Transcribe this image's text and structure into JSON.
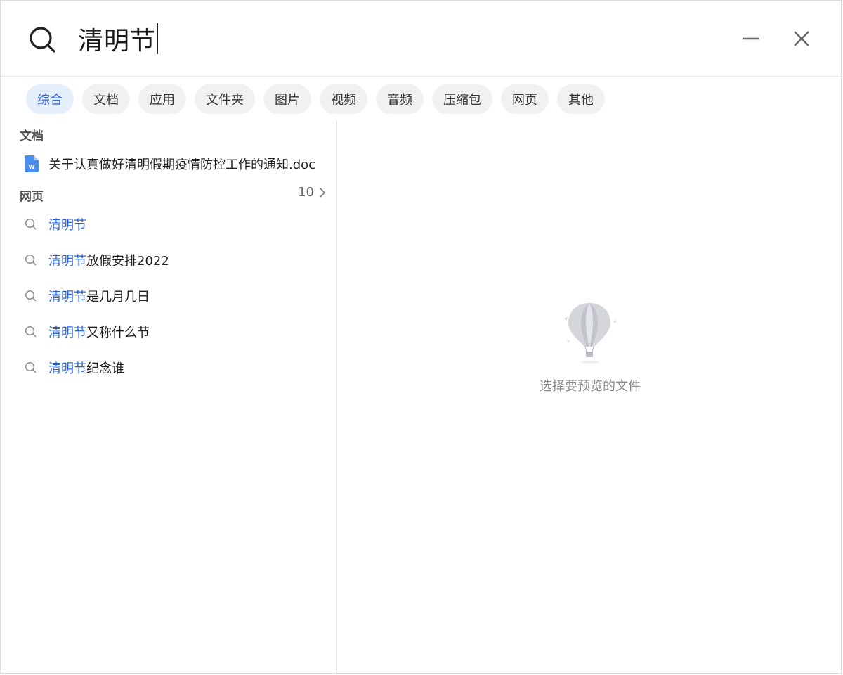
{
  "search": {
    "query": "清明节"
  },
  "filters": [
    {
      "label": "综合",
      "active": true
    },
    {
      "label": "文档",
      "active": false
    },
    {
      "label": "应用",
      "active": false
    },
    {
      "label": "文件夹",
      "active": false
    },
    {
      "label": "图片",
      "active": false
    },
    {
      "label": "视频",
      "active": false
    },
    {
      "label": "音频",
      "active": false
    },
    {
      "label": "压缩包",
      "active": false
    },
    {
      "label": "网页",
      "active": false
    },
    {
      "label": "其他",
      "active": false
    }
  ],
  "documents": {
    "header": "文档",
    "items": [
      {
        "name": "关于认真做好清明假期疫情防控工作的通知.doc",
        "icon": "word-doc-icon"
      }
    ]
  },
  "web": {
    "header": "网页",
    "count": "10",
    "suggestions": [
      {
        "highlight": "清明节",
        "rest": ""
      },
      {
        "highlight": "清明节",
        "rest": "放假安排2022"
      },
      {
        "highlight": "清明节",
        "rest": "是几月几日"
      },
      {
        "highlight": "清明节",
        "rest": "又称什么节"
      },
      {
        "highlight": "清明节",
        "rest": "纪念谁"
      }
    ]
  },
  "preview": {
    "hint": "选择要预览的文件"
  },
  "colors": {
    "accent": "#2b63d9",
    "chip_bg": "#f1f1f1",
    "chip_active_bg": "#e5eefb"
  }
}
